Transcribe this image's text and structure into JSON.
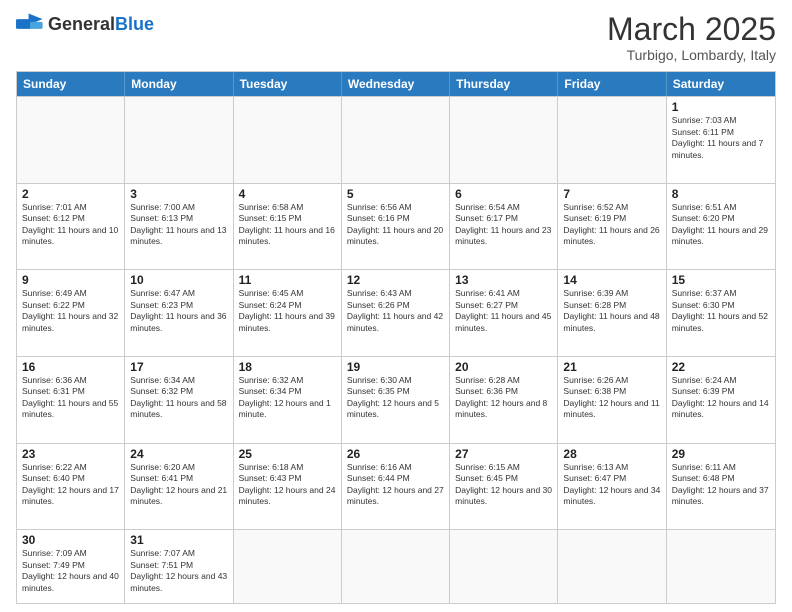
{
  "header": {
    "logo_general": "General",
    "logo_blue": "Blue",
    "month_title": "March 2025",
    "subtitle": "Turbigo, Lombardy, Italy"
  },
  "weekdays": [
    "Sunday",
    "Monday",
    "Tuesday",
    "Wednesday",
    "Thursday",
    "Friday",
    "Saturday"
  ],
  "weeks": [
    [
      {
        "day": "",
        "info": ""
      },
      {
        "day": "",
        "info": ""
      },
      {
        "day": "",
        "info": ""
      },
      {
        "day": "",
        "info": ""
      },
      {
        "day": "",
        "info": ""
      },
      {
        "day": "",
        "info": ""
      },
      {
        "day": "1",
        "info": "Sunrise: 7:03 AM\nSunset: 6:11 PM\nDaylight: 11 hours and 7 minutes."
      }
    ],
    [
      {
        "day": "2",
        "info": "Sunrise: 7:01 AM\nSunset: 6:12 PM\nDaylight: 11 hours and 10 minutes."
      },
      {
        "day": "3",
        "info": "Sunrise: 7:00 AM\nSunset: 6:13 PM\nDaylight: 11 hours and 13 minutes."
      },
      {
        "day": "4",
        "info": "Sunrise: 6:58 AM\nSunset: 6:15 PM\nDaylight: 11 hours and 16 minutes."
      },
      {
        "day": "5",
        "info": "Sunrise: 6:56 AM\nSunset: 6:16 PM\nDaylight: 11 hours and 20 minutes."
      },
      {
        "day": "6",
        "info": "Sunrise: 6:54 AM\nSunset: 6:17 PM\nDaylight: 11 hours and 23 minutes."
      },
      {
        "day": "7",
        "info": "Sunrise: 6:52 AM\nSunset: 6:19 PM\nDaylight: 11 hours and 26 minutes."
      },
      {
        "day": "8",
        "info": "Sunrise: 6:51 AM\nSunset: 6:20 PM\nDaylight: 11 hours and 29 minutes."
      }
    ],
    [
      {
        "day": "9",
        "info": "Sunrise: 6:49 AM\nSunset: 6:22 PM\nDaylight: 11 hours and 32 minutes."
      },
      {
        "day": "10",
        "info": "Sunrise: 6:47 AM\nSunset: 6:23 PM\nDaylight: 11 hours and 36 minutes."
      },
      {
        "day": "11",
        "info": "Sunrise: 6:45 AM\nSunset: 6:24 PM\nDaylight: 11 hours and 39 minutes."
      },
      {
        "day": "12",
        "info": "Sunrise: 6:43 AM\nSunset: 6:26 PM\nDaylight: 11 hours and 42 minutes."
      },
      {
        "day": "13",
        "info": "Sunrise: 6:41 AM\nSunset: 6:27 PM\nDaylight: 11 hours and 45 minutes."
      },
      {
        "day": "14",
        "info": "Sunrise: 6:39 AM\nSunset: 6:28 PM\nDaylight: 11 hours and 48 minutes."
      },
      {
        "day": "15",
        "info": "Sunrise: 6:37 AM\nSunset: 6:30 PM\nDaylight: 11 hours and 52 minutes."
      }
    ],
    [
      {
        "day": "16",
        "info": "Sunrise: 6:36 AM\nSunset: 6:31 PM\nDaylight: 11 hours and 55 minutes."
      },
      {
        "day": "17",
        "info": "Sunrise: 6:34 AM\nSunset: 6:32 PM\nDaylight: 11 hours and 58 minutes."
      },
      {
        "day": "18",
        "info": "Sunrise: 6:32 AM\nSunset: 6:34 PM\nDaylight: 12 hours and 1 minute."
      },
      {
        "day": "19",
        "info": "Sunrise: 6:30 AM\nSunset: 6:35 PM\nDaylight: 12 hours and 5 minutes."
      },
      {
        "day": "20",
        "info": "Sunrise: 6:28 AM\nSunset: 6:36 PM\nDaylight: 12 hours and 8 minutes."
      },
      {
        "day": "21",
        "info": "Sunrise: 6:26 AM\nSunset: 6:38 PM\nDaylight: 12 hours and 11 minutes."
      },
      {
        "day": "22",
        "info": "Sunrise: 6:24 AM\nSunset: 6:39 PM\nDaylight: 12 hours and 14 minutes."
      }
    ],
    [
      {
        "day": "23",
        "info": "Sunrise: 6:22 AM\nSunset: 6:40 PM\nDaylight: 12 hours and 17 minutes."
      },
      {
        "day": "24",
        "info": "Sunrise: 6:20 AM\nSunset: 6:41 PM\nDaylight: 12 hours and 21 minutes."
      },
      {
        "day": "25",
        "info": "Sunrise: 6:18 AM\nSunset: 6:43 PM\nDaylight: 12 hours and 24 minutes."
      },
      {
        "day": "26",
        "info": "Sunrise: 6:16 AM\nSunset: 6:44 PM\nDaylight: 12 hours and 27 minutes."
      },
      {
        "day": "27",
        "info": "Sunrise: 6:15 AM\nSunset: 6:45 PM\nDaylight: 12 hours and 30 minutes."
      },
      {
        "day": "28",
        "info": "Sunrise: 6:13 AM\nSunset: 6:47 PM\nDaylight: 12 hours and 34 minutes."
      },
      {
        "day": "29",
        "info": "Sunrise: 6:11 AM\nSunset: 6:48 PM\nDaylight: 12 hours and 37 minutes."
      }
    ],
    [
      {
        "day": "30",
        "info": "Sunrise: 7:09 AM\nSunset: 7:49 PM\nDaylight: 12 hours and 40 minutes."
      },
      {
        "day": "31",
        "info": "Sunrise: 7:07 AM\nSunset: 7:51 PM\nDaylight: 12 hours and 43 minutes."
      },
      {
        "day": "",
        "info": ""
      },
      {
        "day": "",
        "info": ""
      },
      {
        "day": "",
        "info": ""
      },
      {
        "day": "",
        "info": ""
      },
      {
        "day": "",
        "info": ""
      }
    ]
  ]
}
